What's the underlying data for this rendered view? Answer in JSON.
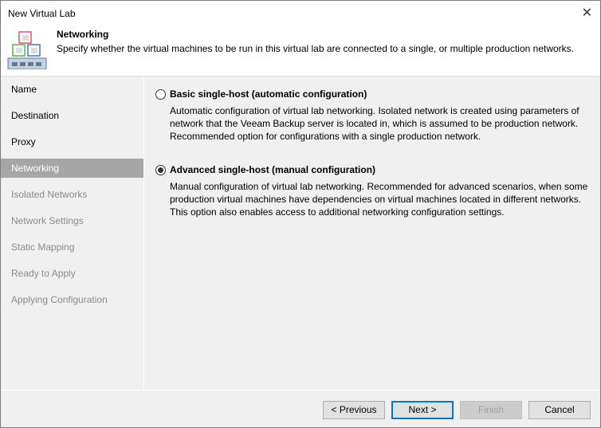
{
  "window": {
    "title": "New Virtual Lab",
    "close_icon": "close-icon"
  },
  "header": {
    "title": "Networking",
    "description": "Specify whether the virtual machines to be run in this virtual lab are connected to a single, or multiple production networks."
  },
  "nav": {
    "items": [
      {
        "label": "Name",
        "state": "normal"
      },
      {
        "label": "Destination",
        "state": "normal"
      },
      {
        "label": "Proxy",
        "state": "normal"
      },
      {
        "label": "Networking",
        "state": "selected"
      },
      {
        "label": "Isolated Networks",
        "state": "disabled"
      },
      {
        "label": "Network Settings",
        "state": "disabled"
      },
      {
        "label": "Static Mapping",
        "state": "disabled"
      },
      {
        "label": "Ready to Apply",
        "state": "disabled"
      },
      {
        "label": "Applying Configuration",
        "state": "disabled"
      }
    ]
  },
  "options": [
    {
      "label": "Basic single-host (automatic configuration)",
      "selected": false,
      "description": "Automatic configuration of virtual lab networking. Isolated network is created using parameters of network that the Veeam Backup server is located in, which is assumed to be production network. Recommended option for configurations with a single production network."
    },
    {
      "label": "Advanced single-host (manual configuration)",
      "selected": true,
      "description": "Manual configuration of virtual lab networking. Recommended for advanced scenarios, when some production virtual machines have dependencies on virtual machines located in different networks. This option also enables access to additional networking configuration settings."
    }
  ],
  "buttons": {
    "previous": "< Previous",
    "next": "Next >",
    "finish": "Finish",
    "cancel": "Cancel"
  }
}
